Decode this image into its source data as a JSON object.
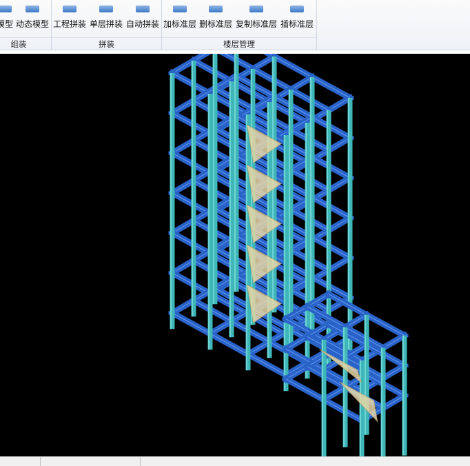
{
  "ribbon": {
    "buttons": [
      {
        "label": "模型"
      },
      {
        "label": "动态模型"
      },
      {
        "label": "工程拼装"
      },
      {
        "label": "单层拼装"
      },
      {
        "label": "自动拼装"
      },
      {
        "label": "加标准层"
      },
      {
        "label": "删标准层"
      },
      {
        "label": "复制标准层"
      },
      {
        "label": "插标准层"
      }
    ],
    "groups": [
      {
        "label": "组装"
      },
      {
        "label": "拼装"
      },
      {
        "label": "楼层管理"
      }
    ]
  },
  "colors": {
    "beam": "#2a63c8",
    "beam_edge": "#6ea2ff",
    "column": "#3fb6b8",
    "column_edge": "#9cf3f2",
    "stair": "#e7d6a6",
    "background": "#000000"
  },
  "icons": [
    "model-icon",
    "dynamic-model-icon",
    "project-assemble-icon",
    "single-floor-assemble-icon",
    "auto-assemble-icon",
    "add-std-floor-icon",
    "delete-std-floor-icon",
    "copy-std-floor-icon",
    "insert-std-floor-icon"
  ]
}
